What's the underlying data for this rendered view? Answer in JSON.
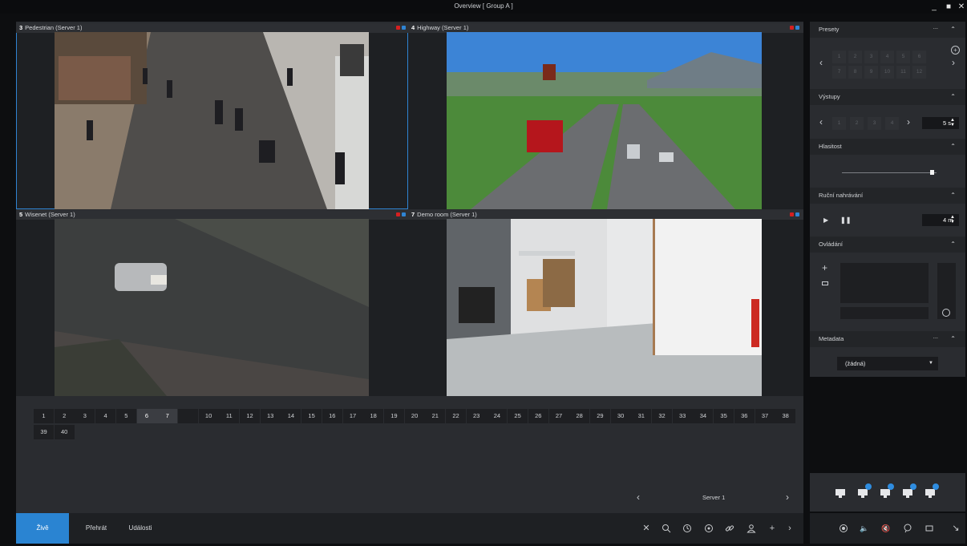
{
  "window": {
    "title": "Overview  [ Group A ]",
    "minimize": "_",
    "maximize": "■",
    "close": "✕"
  },
  "tiles": [
    {
      "num": "3",
      "name": "Pedestrian (Server 1)"
    },
    {
      "num": "4",
      "name": "Highway (Server 1)"
    },
    {
      "num": "5",
      "name": "Wisenet (Server 1)"
    },
    {
      "num": "7",
      "name": "Demo room (Server 1)"
    }
  ],
  "layout_numbers": [
    "1",
    "2",
    "3",
    "4",
    "5",
    "6",
    "7",
    "",
    "10",
    "11",
    "12",
    "13",
    "14",
    "15",
    "16",
    "17",
    "18",
    "19",
    "20",
    "21",
    "22",
    "23",
    "24",
    "25",
    "26",
    "27",
    "28",
    "29",
    "30",
    "31",
    "32",
    "33",
    "34",
    "35",
    "36",
    "37",
    "38",
    "39",
    "40"
  ],
  "server_nav": {
    "label": "Server 1",
    "prev": "‹",
    "next": "›"
  },
  "tabs": {
    "live": "Živě",
    "playback": "Přehrát",
    "events": "Události"
  },
  "toolbar_icons": [
    "close-icon",
    "search-icon",
    "clock-icon",
    "target-icon",
    "link-icon",
    "user-icon",
    "plus-icon",
    "chevron-right-icon"
  ],
  "panel": {
    "presets": {
      "title": "Presety",
      "more": "...",
      "numbers": [
        "1",
        "2",
        "3",
        "4",
        "5",
        "6",
        "7",
        "8",
        "9",
        "10",
        "11",
        "12"
      ]
    },
    "outputs": {
      "title": "Výstupy",
      "numbers": [
        "1",
        "2",
        "3",
        "4"
      ],
      "interval": "5 s"
    },
    "volume": {
      "title": "Hlasitost",
      "level": 0.95
    },
    "manual_rec": {
      "title": "Ruční nahrávání",
      "duration": "4 m"
    },
    "control": {
      "title": "Ovládání"
    },
    "metadata": {
      "title": "Metadata",
      "more": "...",
      "selected": "(žádná)"
    }
  },
  "colors": {
    "accent": "#2a84d2",
    "rec": "#d62020",
    "live": "#2f84d3"
  }
}
